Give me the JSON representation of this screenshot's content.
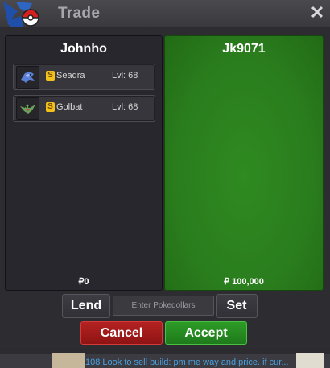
{
  "window": {
    "title": "Trade",
    "logo_icon": "pokeball-logo-icon",
    "close_icon": "close-icon",
    "close_glyph": "✕"
  },
  "left_panel": {
    "player_name": "Johnho",
    "items": [
      {
        "sprite_icon": "seadra-sprite-icon",
        "coin_glyph": "S",
        "name": "Seadra",
        "level": "Lvl: 68"
      },
      {
        "sprite_icon": "golbat-sprite-icon",
        "coin_glyph": "S",
        "name": "Golbat",
        "level": "Lvl: 68"
      }
    ],
    "money": "₽0"
  },
  "right_panel": {
    "player_name": "Jk9071",
    "money": "₽ 100,000"
  },
  "controls": {
    "lend_label": "Lend",
    "money_placeholder": "Enter Pokedollars",
    "set_label": "Set",
    "cancel_label": "Cancel",
    "accept_label": "Accept"
  },
  "chat": {
    "text": "108 Look to sell build: pm me way and price. if cur..."
  },
  "colors": {
    "accent_green": "#2a7d1d",
    "cancel_red": "#a01a1a",
    "accept_green": "#2a8d23",
    "coin_gold": "#f2c21b"
  }
}
